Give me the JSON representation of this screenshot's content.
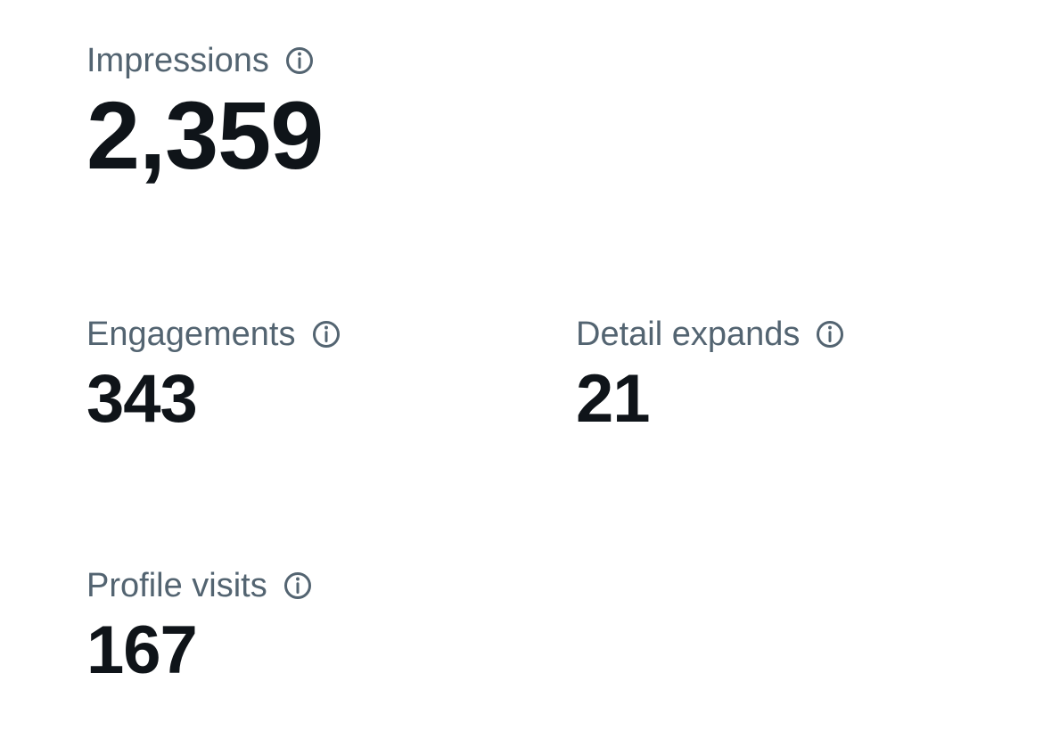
{
  "metrics": {
    "impressions": {
      "label": "Impressions",
      "value": "2,359",
      "icon": "info-icon"
    },
    "engagements": {
      "label": "Engagements",
      "value": "343",
      "icon": "info-icon"
    },
    "detail_expands": {
      "label": "Detail expands",
      "value": "21",
      "icon": "info-icon"
    },
    "profile_visits": {
      "label": "Profile visits",
      "value": "167",
      "icon": "info-icon"
    }
  },
  "colors": {
    "label": "#536471",
    "value": "#0f1419",
    "background": "#ffffff"
  }
}
